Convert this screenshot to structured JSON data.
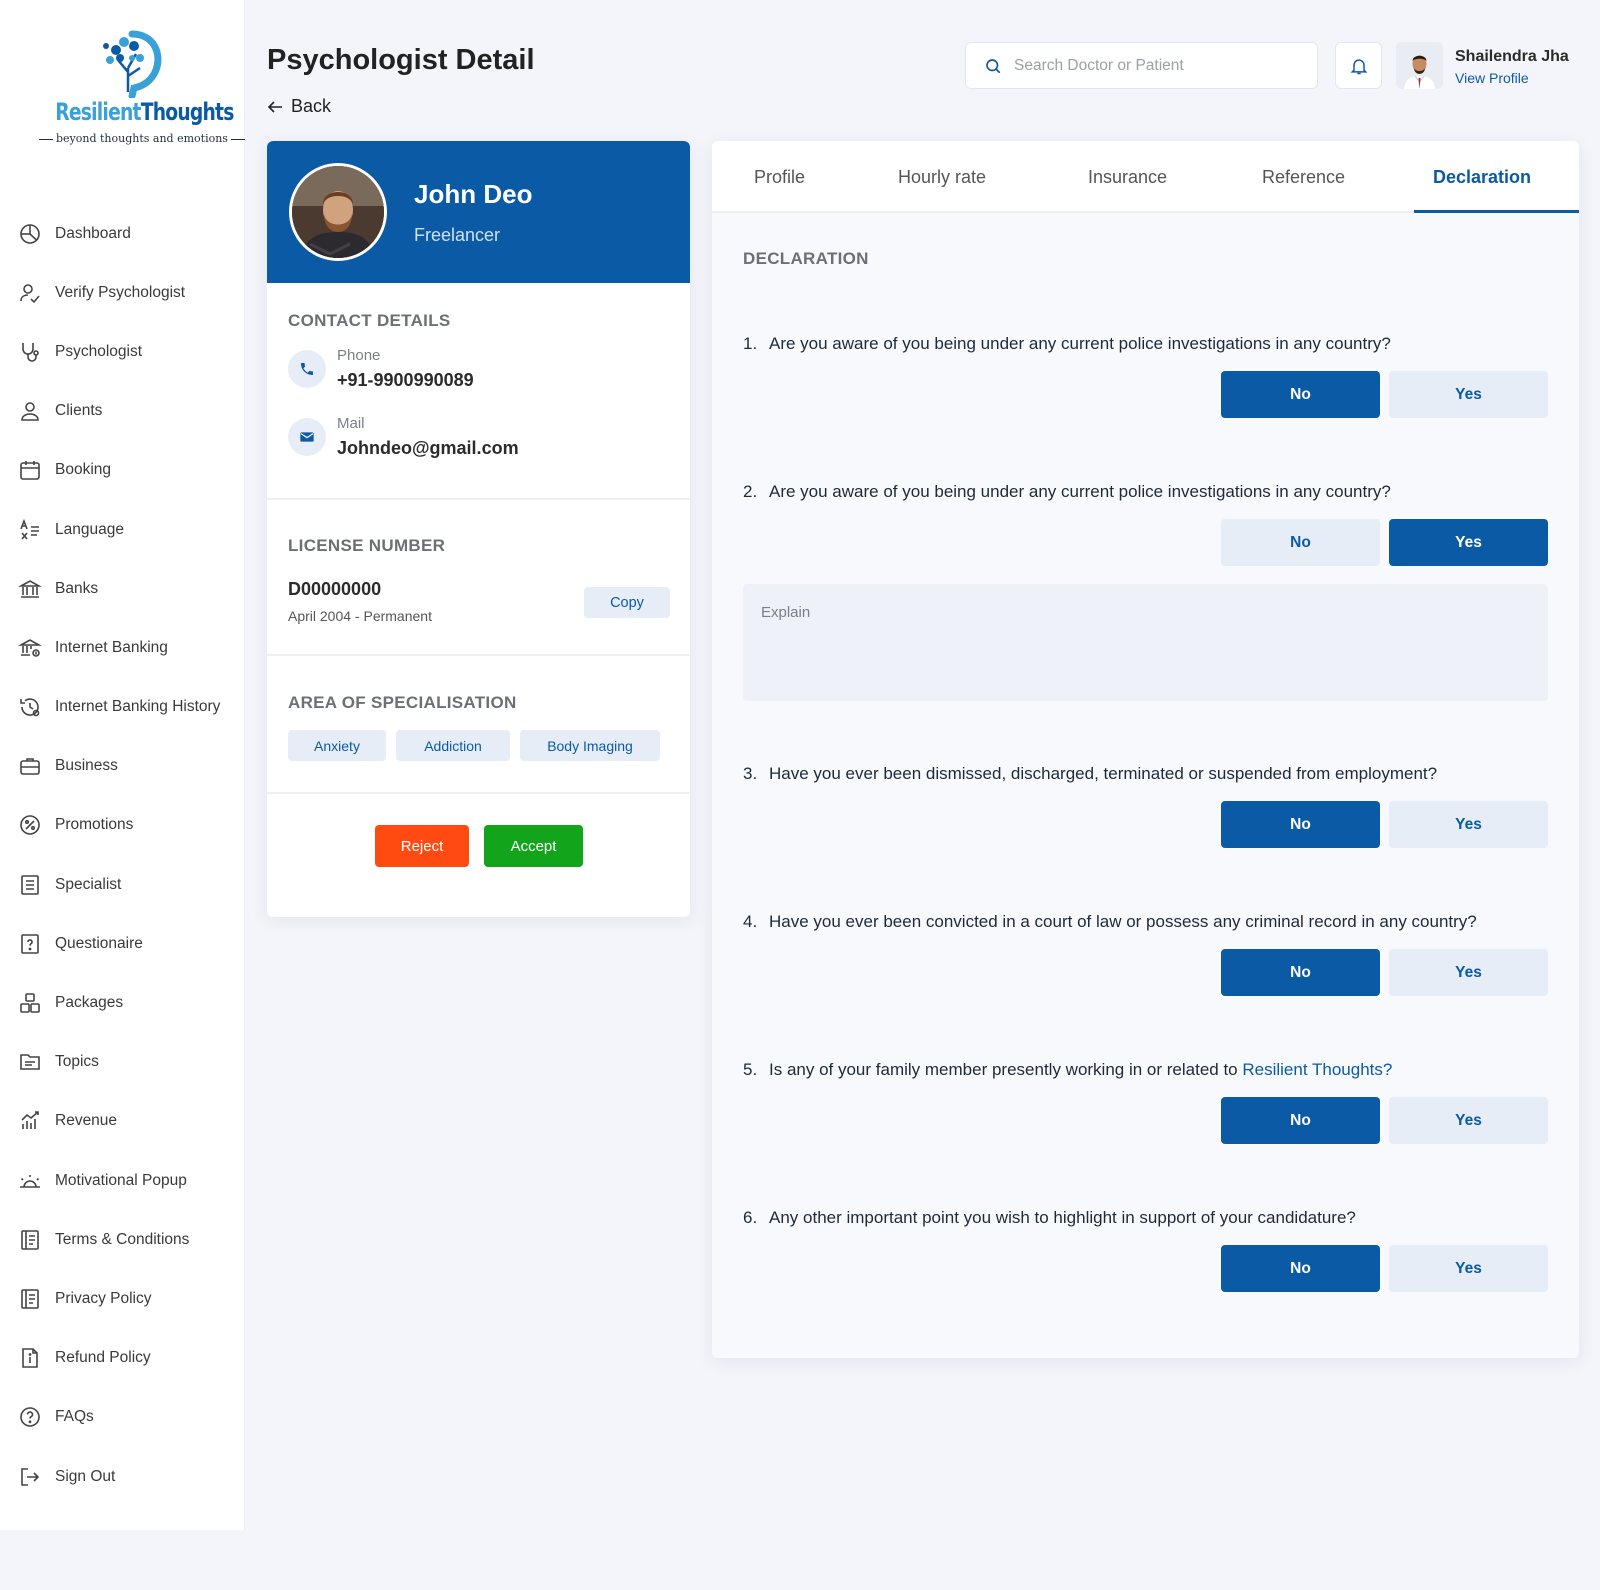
{
  "brand": {
    "name_part1": "Resilient",
    "name_part2": "Thoughts",
    "tagline": "beyond thoughts and emotions"
  },
  "sidebar": {
    "items": [
      {
        "label": "Dashboard",
        "icon": "dashboard-icon"
      },
      {
        "label": "Verify Psychologist",
        "icon": "verify-user-icon"
      },
      {
        "label": "Psychologist",
        "icon": "stethoscope-icon"
      },
      {
        "label": "Clients",
        "icon": "user-icon"
      },
      {
        "label": "Booking",
        "icon": "calendar-icon"
      },
      {
        "label": "Language",
        "icon": "language-icon"
      },
      {
        "label": "Banks",
        "icon": "bank-icon"
      },
      {
        "label": "Internet Banking",
        "icon": "online-bank-icon"
      },
      {
        "label": "Internet Banking History",
        "icon": "history-icon"
      },
      {
        "label": "Business",
        "icon": "briefcase-icon"
      },
      {
        "label": "Promotions",
        "icon": "percent-icon"
      },
      {
        "label": "Specialist",
        "icon": "list-icon"
      },
      {
        "label": "Questionaire",
        "icon": "question-box-icon"
      },
      {
        "label": "Packages",
        "icon": "packages-icon"
      },
      {
        "label": "Topics",
        "icon": "topics-icon"
      },
      {
        "label": "Revenue",
        "icon": "chart-icon"
      },
      {
        "label": "Motivational Popup",
        "icon": "sunrise-icon"
      },
      {
        "label": "Terms & Conditions",
        "icon": "document-icon"
      },
      {
        "label": "Privacy Policy",
        "icon": "document-icon"
      },
      {
        "label": "Refund Policy",
        "icon": "file-info-icon"
      },
      {
        "label": "FAQs",
        "icon": "help-icon"
      },
      {
        "label": "Sign Out",
        "icon": "sign-out-icon"
      }
    ]
  },
  "header": {
    "title": "Psychologist Detail",
    "back_label": "Back",
    "search_placeholder": "Search Doctor or Patient",
    "user_name": "Shailendra Jha",
    "user_link": "View Profile"
  },
  "profile": {
    "name": "John Deo",
    "role": "Freelancer",
    "contact_title": "CONTACT DETAILS",
    "phone_label": "Phone",
    "phone_value": "+91-9900990089",
    "mail_label": "Mail",
    "mail_value": "Johndeo@gmail.com",
    "license_title": "LICENSE NUMBER",
    "license_number": "D00000000",
    "license_date": "April 2004 - Permanent",
    "copy_label": "Copy",
    "spec_title": "AREA OF SPECIALISATION",
    "specialisations": [
      "Anxiety",
      "Addiction",
      "Body Imaging"
    ],
    "reject_label": "Reject",
    "accept_label": "Accept"
  },
  "tabs": [
    "Profile",
    "Hourly rate",
    "Insurance",
    "Reference",
    "Declaration"
  ],
  "active_tab": "Declaration",
  "declaration": {
    "title": "DECLARATION",
    "no_label": "No",
    "yes_label": "Yes",
    "explain_placeholder": "Explain",
    "questions": [
      {
        "num": "1.",
        "text": "Are you aware of you being under any current police investigations in any country?",
        "answer": "No"
      },
      {
        "num": "2.",
        "text": "Are you aware of you being under any current police investigations in any  country?",
        "answer": "Yes"
      },
      {
        "num": "3.",
        "text": "Have you ever been dismissed, discharged, terminated or suspended from employment?",
        "answer": "No"
      },
      {
        "num": "4.",
        "text": "Have you ever been convicted in a court of law or possess any criminal record in any country?",
        "answer": "No"
      },
      {
        "num": "5.",
        "text": "Is any of your family member presently working in or related to ",
        "highlight": "Resilient Thoughts?",
        "answer": "No"
      },
      {
        "num": "6.",
        "text": "Any other important point you wish to highlight in support of your candidature?",
        "answer": "No"
      }
    ]
  },
  "colors": {
    "primary": "#0b5aa6",
    "reject": "#ff4b12",
    "accept": "#12a51b",
    "chip_bg": "#e6edf6"
  }
}
